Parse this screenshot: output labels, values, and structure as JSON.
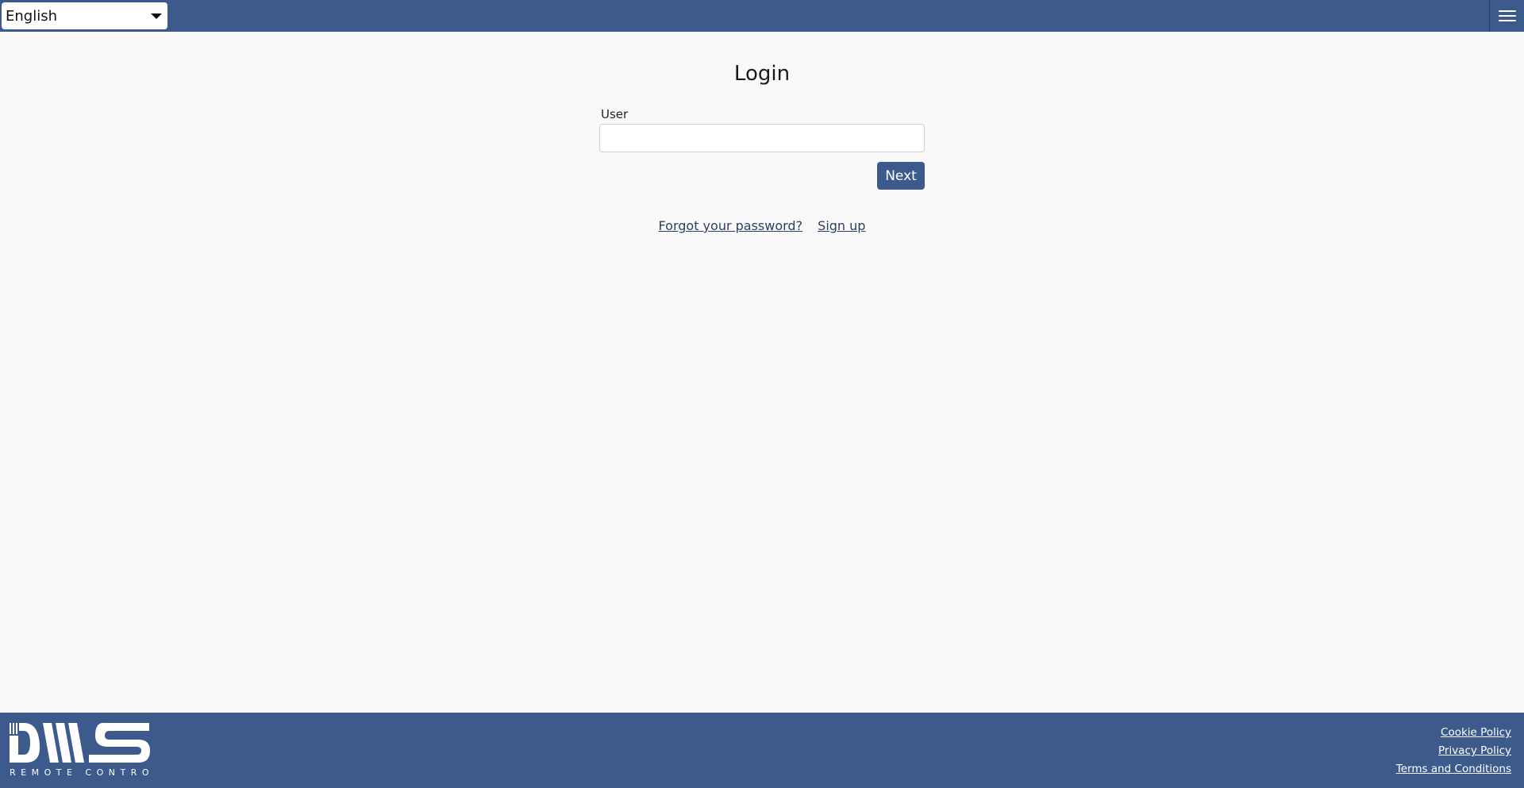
{
  "header": {
    "language_select": {
      "value": "English"
    },
    "menu_icon": "hamburger-menu-icon"
  },
  "login": {
    "title": "Login",
    "user_label": "User",
    "user_value": "",
    "next_label": "Next",
    "forgot_password_link": "Forgot your password?",
    "sign_up_link": "Sign up"
  },
  "footer": {
    "logo_text": "DWS",
    "logo_tagline": "REMOTE CONTROL",
    "links": [
      "Cookie Policy",
      "Privacy Policy",
      "Terms and Conditions"
    ]
  },
  "colors": {
    "brand": "#3d5a8c",
    "background": "#faf9f9",
    "link": "#2c3e66"
  }
}
